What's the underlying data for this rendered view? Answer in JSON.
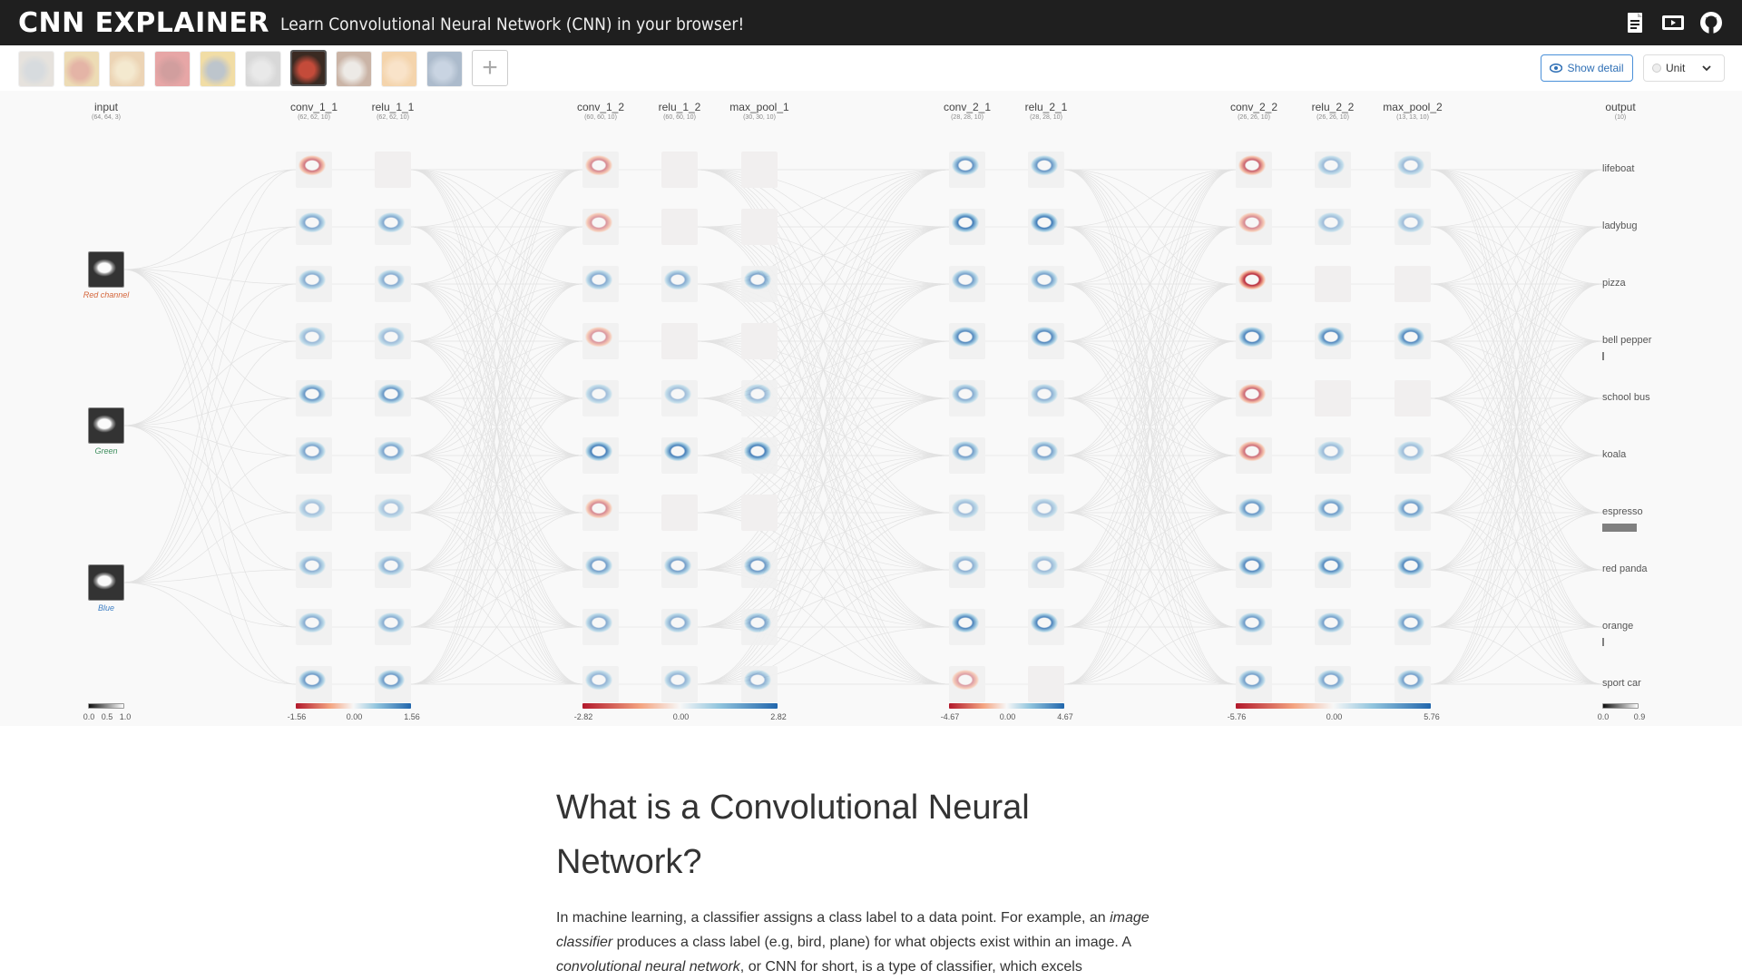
{
  "header": {
    "logo": "CNN EXPLAINER",
    "tagline": "Learn Convolutional Neural Network (CNN) in your browser!",
    "icons": [
      "paper-icon",
      "video-icon",
      "github-icon"
    ]
  },
  "controls": {
    "thumbnails": [
      {
        "name": "lifeboat",
        "selected": false
      },
      {
        "name": "ladybug",
        "selected": false
      },
      {
        "name": "pizza",
        "selected": false
      },
      {
        "name": "bell pepper",
        "selected": false
      },
      {
        "name": "school bus",
        "selected": false
      },
      {
        "name": "koala",
        "selected": false
      },
      {
        "name": "espresso",
        "selected": true
      },
      {
        "name": "red panda",
        "selected": false
      },
      {
        "name": "orange",
        "selected": false
      },
      {
        "name": "sport car",
        "selected": false
      }
    ],
    "add_icon": "plus-icon",
    "show_detail_label": "Show detail",
    "unit_label": "Unit"
  },
  "network": {
    "layers": [
      {
        "name": "input",
        "dims": "(64, 64, 3)"
      },
      {
        "name": "conv_1_1",
        "dims": "(62, 62, 10)"
      },
      {
        "name": "relu_1_1",
        "dims": "(62, 62, 10)"
      },
      {
        "name": "conv_1_2",
        "dims": "(60, 60, 10)"
      },
      {
        "name": "relu_1_2",
        "dims": "(60, 60, 10)"
      },
      {
        "name": "max_pool_1",
        "dims": "(30, 30, 10)"
      },
      {
        "name": "conv_2_1",
        "dims": "(28, 28, 10)"
      },
      {
        "name": "relu_2_1",
        "dims": "(28, 28, 10)"
      },
      {
        "name": "conv_2_2",
        "dims": "(26, 26, 10)"
      },
      {
        "name": "relu_2_2",
        "dims": "(26, 26, 10)"
      },
      {
        "name": "max_pool_2",
        "dims": "(13, 13, 10)"
      },
      {
        "name": "output",
        "dims": "(10)"
      }
    ],
    "input_channels": [
      {
        "label": "Red channel",
        "color": "#d4653a"
      },
      {
        "label": "Green",
        "color": "#3e8e5e"
      },
      {
        "label": "Blue",
        "color": "#3f7fc4"
      }
    ],
    "outputs": [
      {
        "label": "lifeboat",
        "prob": 0.0
      },
      {
        "label": "ladybug",
        "prob": 0.0
      },
      {
        "label": "pizza",
        "prob": 0.0
      },
      {
        "label": "bell pepper",
        "prob": 0.02
      },
      {
        "label": "school bus",
        "prob": 0.0
      },
      {
        "label": "koala",
        "prob": 0.0
      },
      {
        "label": "espresso",
        "prob": 0.94
      },
      {
        "label": "red panda",
        "prob": 0.0
      },
      {
        "label": "orange",
        "prob": 0.04
      },
      {
        "label": "sport car",
        "prob": 0.0
      }
    ],
    "legends": [
      {
        "values": [
          "0.0",
          "0.5",
          "1.0"
        ],
        "type": "gray"
      },
      {
        "values": [
          "-1.56",
          "0.00",
          "1.56"
        ],
        "type": "diverging"
      },
      {
        "values": [
          "-2.82",
          "0.00",
          "2.82"
        ],
        "type": "diverging"
      },
      {
        "values": [
          "-4.67",
          "0.00",
          "4.67"
        ],
        "type": "diverging"
      },
      {
        "values": [
          "-5.76",
          "0.00",
          "5.76"
        ],
        "type": "diverging"
      },
      {
        "values": [
          "0.0",
          "0.9"
        ],
        "type": "gray"
      }
    ],
    "colors": {
      "negative": "#b2182b",
      "neutral": "#f7f7f7",
      "positive": "#2166ac"
    }
  },
  "article": {
    "title": "What is a Convolutional Neural Network?",
    "p1_a": "In machine learning, a classifier assigns a class label to a data point. For example, an ",
    "p1_em1": "image classifier",
    "p1_b": " produces a class label (e.g, bird, plane) for what objects exist within an image. A ",
    "p1_em2": "convolutional neural network",
    "p1_c": ", or CNN for short, is a type of classifier, which excels"
  }
}
